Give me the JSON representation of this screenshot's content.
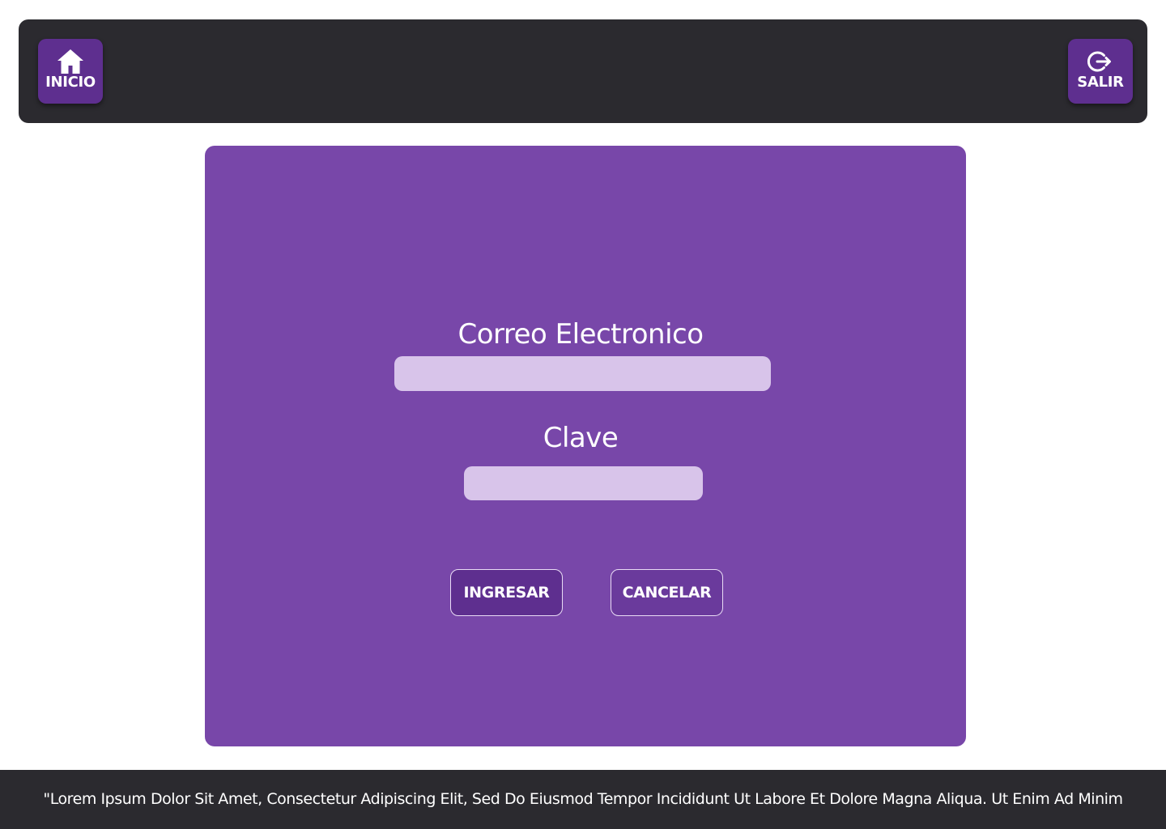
{
  "colors": {
    "header_bg": "#2b2a2f",
    "nav_button_bg": "#5e2f8f",
    "card_bg": "#7847a9",
    "input_bg": "#d8c4ea",
    "footer_bg": "#2b2a2f",
    "text": "#ffffff"
  },
  "header": {
    "home_button": {
      "label": "INICIO",
      "icon": "home-icon"
    },
    "exit_button": {
      "label": "SALIR",
      "icon": "logout-icon"
    }
  },
  "login_form": {
    "email_label": "Correo Electronico",
    "email_value": "",
    "password_label": "Clave",
    "password_value": "",
    "submit_label": "INGRESAR",
    "cancel_label": "CANCELAR"
  },
  "footer": {
    "text": "\"Lorem Ipsum Dolor Sit Amet, Consectetur Adipiscing Elit, Sed Do Eiusmod Tempor Incididunt Ut Labore Et Dolore Magna Aliqua. Ut Enim Ad Minim"
  }
}
